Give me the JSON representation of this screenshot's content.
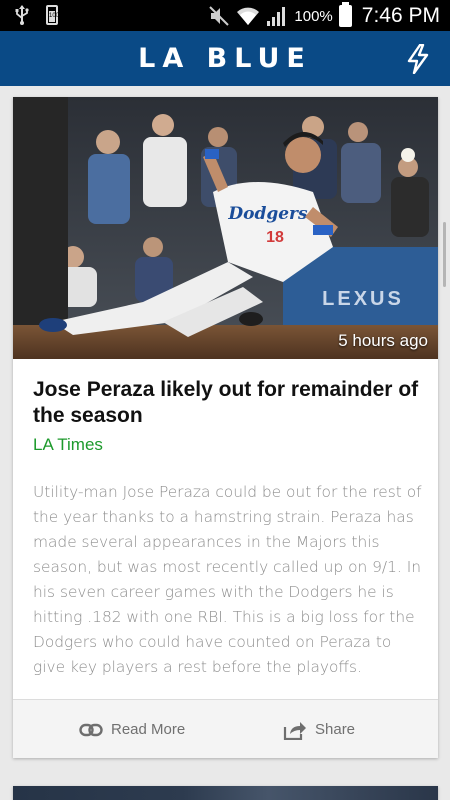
{
  "status_bar": {
    "battery_small_label": "100",
    "battery_percent": "100%",
    "time": "7:46 PM"
  },
  "app_bar": {
    "title": "LA BLUE"
  },
  "article": {
    "time_ago": "5 hours ago",
    "headline": "Jose Peraza likely out for remainder of the season",
    "source": "LA Times",
    "summary": "Utility-man Jose Peraza could be out for the rest of the year thanks to a hamstring strain. Peraza has made several appearances in the Majors this season, but was most recently called up on 9/1. In his seven career games with the Dodgers he is hitting .182 with one RBI. This is a big loss for the Dodgers who could have counted on Peraza to give key players a rest before the playoffs.",
    "photo_jersey_text": "Dodgers",
    "photo_number": "18",
    "photo_sign_text": "LEXUS"
  },
  "actions": {
    "read_more_label": "Read More",
    "share_label": "Share"
  },
  "colors": {
    "app_bar": "#0a4a86",
    "source_green": "#1d9a2c"
  }
}
